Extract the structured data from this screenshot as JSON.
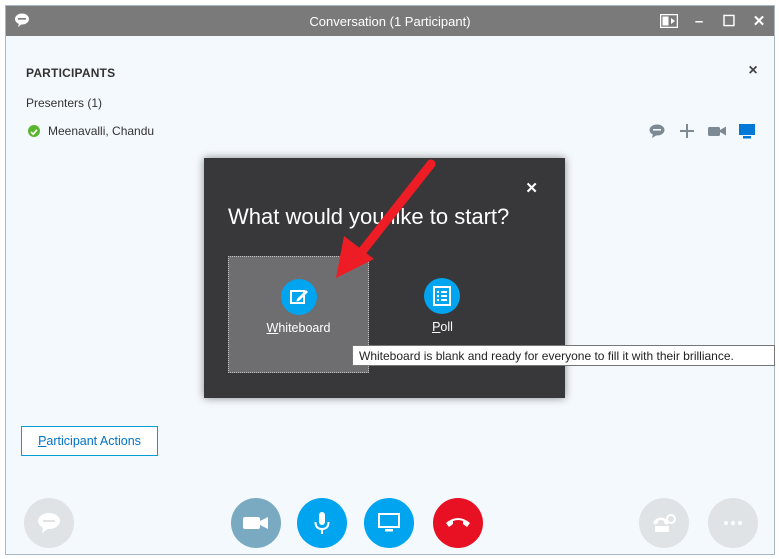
{
  "window": {
    "title": "Conversation (1 Participant)",
    "minimize_glyph": "–",
    "maximize_glyph": "☐",
    "close_glyph": "✕"
  },
  "participants": {
    "section_title": "PARTICIPANTS",
    "close_glyph": "×",
    "presenters_label": "Presenters (1)",
    "items": [
      {
        "name": "Meenavalli, Chandu",
        "status": "available",
        "status_color": "#5ab52e"
      }
    ]
  },
  "modal": {
    "close_glyph": "✕",
    "title": "What would you like to start?",
    "options": [
      {
        "label_accel": "W",
        "label_rest": "hiteboard",
        "icon": "whiteboard-icon",
        "selected": true
      },
      {
        "label_accel": "P",
        "label_rest": "oll",
        "icon": "poll-icon",
        "selected": false
      }
    ],
    "tooltip": "Whiteboard is blank and ready for everyone to fill it with their brilliance."
  },
  "actions": {
    "participant_actions_accel": "P",
    "participant_actions_rest": "articipant Actions"
  },
  "colors": {
    "accent_blue": "#00a4ef",
    "end_call_red": "#e81123",
    "modal_bg": "#38383b",
    "titlebar_bg": "#7a7a7a",
    "arrow_red": "#ee1c24"
  }
}
